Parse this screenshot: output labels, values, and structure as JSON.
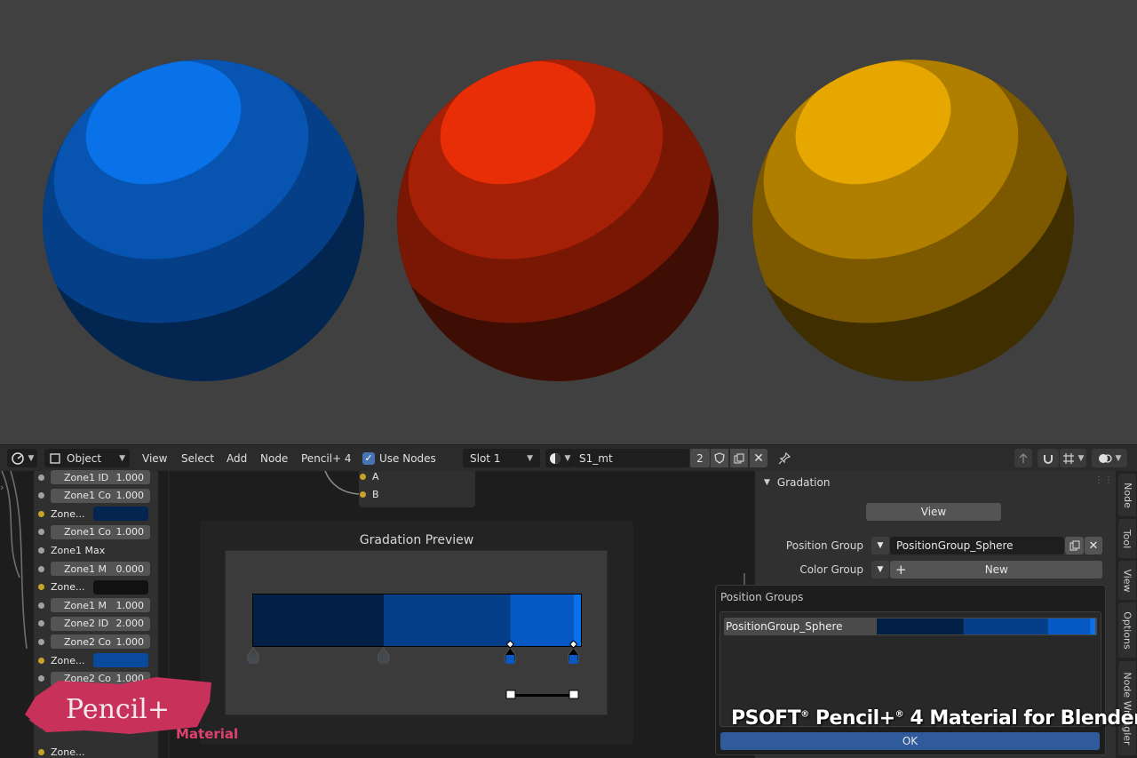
{
  "colors": {
    "viewport_bg": "#3f3f3f",
    "header_bg": "#2b2b2b",
    "panel_bg": "#303030",
    "accent_blue": "#2f5a9c",
    "logo_pink": "#c8325a"
  },
  "spheres": [
    {
      "name": "blue",
      "light": "#0a72e8",
      "mid": "#0755b0",
      "dark": "#043f87",
      "darker": "#02264f"
    },
    {
      "name": "red",
      "light": "#e82e06",
      "mid": "#a52006",
      "dark": "#771704",
      "darker": "#3e0d03"
    },
    {
      "name": "yellow",
      "light": "#e6a800",
      "mid": "#b07f00",
      "dark": "#7c5900",
      "darker": "#3e2e00"
    }
  ],
  "header": {
    "editor_type_icon": "node-editor-icon",
    "mode": "Object",
    "menus": [
      "View",
      "Select",
      "Add",
      "Node",
      "Pencil+ 4"
    ],
    "use_nodes_label": "Use Nodes",
    "use_nodes_checked": true,
    "slot": "Slot 1",
    "material_name": "S1_mt",
    "user_count": "2"
  },
  "left_node": {
    "rows": [
      {
        "kind": "field",
        "label": "Zone1 ID",
        "value": "1.000",
        "socket": "gray"
      },
      {
        "kind": "field",
        "label": "Zone1 Co",
        "value": "1.000",
        "socket": "gray"
      },
      {
        "kind": "color",
        "label": "Zone...",
        "color": "#03254f",
        "socket": "yellow"
      },
      {
        "kind": "field",
        "label": "Zone1 Co",
        "value": "1.000",
        "socket": "gray"
      },
      {
        "kind": "text",
        "label": "Zone1 Max",
        "socket": "gray"
      },
      {
        "kind": "field",
        "label": "Zone1 M",
        "value": "0.000",
        "socket": "gray"
      },
      {
        "kind": "color",
        "label": "Zone...",
        "color": "#111111",
        "socket": "yellow"
      },
      {
        "kind": "field",
        "label": "Zone1 M",
        "value": "1.000",
        "socket": "gray"
      },
      {
        "kind": "field",
        "label": "Zone2 ID",
        "value": "2.000",
        "socket": "gray"
      },
      {
        "kind": "field",
        "label": "Zone2 Co",
        "value": "1.000",
        "socket": "gray"
      },
      {
        "kind": "color",
        "label": "Zone...",
        "color": "#0a4a9c",
        "socket": "yellow"
      },
      {
        "kind": "field",
        "label": "Zone2 Co",
        "value": "1.000",
        "socket": "gray"
      }
    ],
    "bottom_label": "Zone..."
  },
  "ab_node": {
    "inputs": [
      "A",
      "B"
    ]
  },
  "gradation_preview": {
    "title": "Gradation Preview",
    "segments": [
      {
        "color": "#021f45",
        "portion": 0.35
      },
      {
        "color": "#053f8a",
        "portion": 0.34
      },
      {
        "color": "#0659c4",
        "portion": 0.17
      },
      {
        "color": "#0a72e8",
        "portion": 0.02
      }
    ]
  },
  "panel": {
    "section_title": "Gradation",
    "view_button": "View",
    "position_group_label": "Position Group",
    "position_group_value": "PositionGroup_Sphere",
    "color_group_label": "Color Group",
    "color_group_new": "New"
  },
  "popup": {
    "title": "Position Groups",
    "item_name": "PositionGroup_Sphere",
    "ok_label": "OK"
  },
  "side_tabs": [
    "Node",
    "Tool",
    "View",
    "Options",
    "Node Wrangler"
  ],
  "watermark": {
    "brand": "PSOFT",
    "product": "Pencil+",
    "version": "4",
    "rest": "Material for Blender"
  },
  "logo": {
    "text": "Pencil+",
    "sub": "Material"
  }
}
